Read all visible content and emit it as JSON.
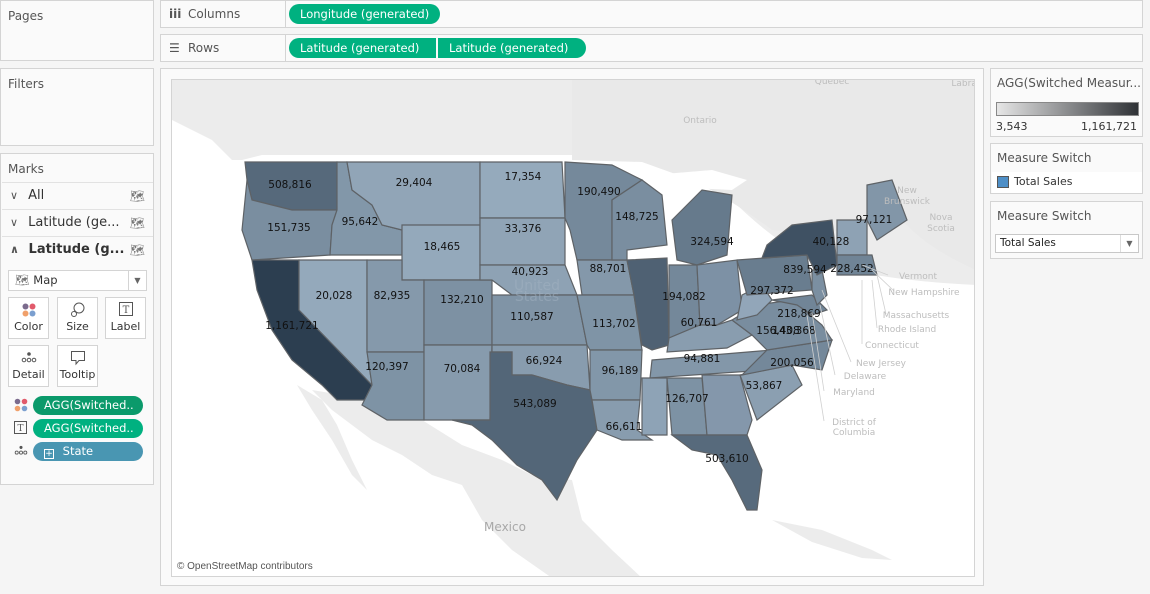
{
  "panels": {
    "pages_title": "Pages",
    "filters_title": "Filters",
    "marks_title": "Marks"
  },
  "shelves": {
    "columns": {
      "label": "Columns",
      "icon": "columns-icon",
      "pills": [
        "Longitude (generated)"
      ]
    },
    "rows": {
      "label": "Rows",
      "icon": "rows-icon",
      "pills": [
        "Latitude (generated)",
        "Latitude (generated)"
      ]
    }
  },
  "marks": {
    "layers": [
      {
        "label": "All",
        "expanded": false,
        "bold": false
      },
      {
        "label": "Latitude (ge...",
        "expanded": false,
        "bold": false
      },
      {
        "label": "Latitude (g...",
        "expanded": true,
        "bold": true
      }
    ],
    "mark_type": "Map",
    "buttons": [
      "Color",
      "Size",
      "Label",
      "Detail",
      "Tooltip"
    ],
    "fields": [
      {
        "encoding": "color",
        "label": "AGG(Switched..",
        "color": "#0b9a6b"
      },
      {
        "encoding": "label",
        "label": "AGG(Switched..",
        "color": "#00b180"
      },
      {
        "encoding": "detail",
        "label": "State",
        "color": "#4996b2"
      }
    ]
  },
  "legend_color": {
    "title": "AGG(Switched Measur...",
    "min_label": "3,543",
    "max_label": "1,161,721",
    "gradient_from": "#e6e6e6",
    "gradient_to": "#2f3236"
  },
  "legend_measure": {
    "title": "Measure Switch",
    "item": "Total Sales",
    "swatch": "#4e8fc7"
  },
  "parameter": {
    "title": "Measure Switch",
    "value": "Total Sales"
  },
  "map": {
    "attribution": "© OpenStreetMap contributors",
    "geo_labels": [
      "Ontario",
      "Quebec",
      "Labrad",
      "New Brunswick",
      "Nova Scotia",
      "Mexico",
      "United States"
    ],
    "callouts": [
      "Vermont",
      "New Hampshire",
      "Massachusetts",
      "Rhode Island",
      "Connecticut",
      "New Jersey",
      "Delaware",
      "Maryland",
      "District of Columbia"
    ],
    "color_range": {
      "min": 3543,
      "max": 1161721,
      "low": "#9fb4c6",
      "high": "#2c3e50"
    }
  },
  "chart_data": {
    "type": "choropleth",
    "title": "",
    "measure": "Total Sales",
    "color_range": [
      3543,
      1161721
    ],
    "regions": [
      {
        "state": "Washington",
        "value": 508816
      },
      {
        "state": "Oregon",
        "value": 151735
      },
      {
        "state": "California",
        "value": 1161721
      },
      {
        "state": "Idaho",
        "value": 95642
      },
      {
        "state": "Nevada",
        "value": 20028
      },
      {
        "state": "Montana",
        "value": 29404
      },
      {
        "state": "Wyoming",
        "value": 18465
      },
      {
        "state": "Utah",
        "value": 82935
      },
      {
        "state": "Arizona",
        "value": 120397
      },
      {
        "state": "Colorado",
        "value": 132210
      },
      {
        "state": "New Mexico",
        "value": 70084
      },
      {
        "state": "North Dakota",
        "value": 17354
      },
      {
        "state": "South Dakota",
        "value": 33376
      },
      {
        "state": "Nebraska",
        "value": 40923
      },
      {
        "state": "Kansas",
        "value": 110587
      },
      {
        "state": "Oklahoma",
        "value": 66924
      },
      {
        "state": "Texas",
        "value": 543089
      },
      {
        "state": "Minnesota",
        "value": 190490
      },
      {
        "state": "Iowa",
        "value": 88701
      },
      {
        "state": "Missouri",
        "value": 113702
      },
      {
        "state": "Arkansas",
        "value": 96189
      },
      {
        "state": "Louisiana",
        "value": 66611
      },
      {
        "state": "Wisconsin",
        "value": 148725
      },
      {
        "state": "Illinois",
        "value": null
      },
      {
        "state": "Indiana",
        "value": 194082
      },
      {
        "state": "Michigan",
        "value": 324594
      },
      {
        "state": "Ohio",
        "value": null
      },
      {
        "state": "Kentucky",
        "value": 60761
      },
      {
        "state": "Tennessee",
        "value": 94881
      },
      {
        "state": "Mississippi",
        "value": null
      },
      {
        "state": "Alabama",
        "value": 126707
      },
      {
        "state": "Georgia",
        "value": null
      },
      {
        "state": "Florida",
        "value": 503610
      },
      {
        "state": "South Carolina",
        "value": 53867
      },
      {
        "state": "North Carolina",
        "value": 200056
      },
      {
        "state": "Virginia",
        "value": 156408
      },
      {
        "state": "West Virginia",
        "value": null
      },
      {
        "state": "Maryland",
        "value": 218869
      },
      {
        "state": "Pennsylvania",
        "value": 297372
      },
      {
        "state": "New Jersey",
        "value": 143368
      },
      {
        "state": "New York",
        "value": 839594
      },
      {
        "state": "Vermont",
        "value": 40128
      },
      {
        "state": "Massachusetts",
        "value": 228452
      },
      {
        "state": "Maine",
        "value": 97121
      }
    ]
  }
}
